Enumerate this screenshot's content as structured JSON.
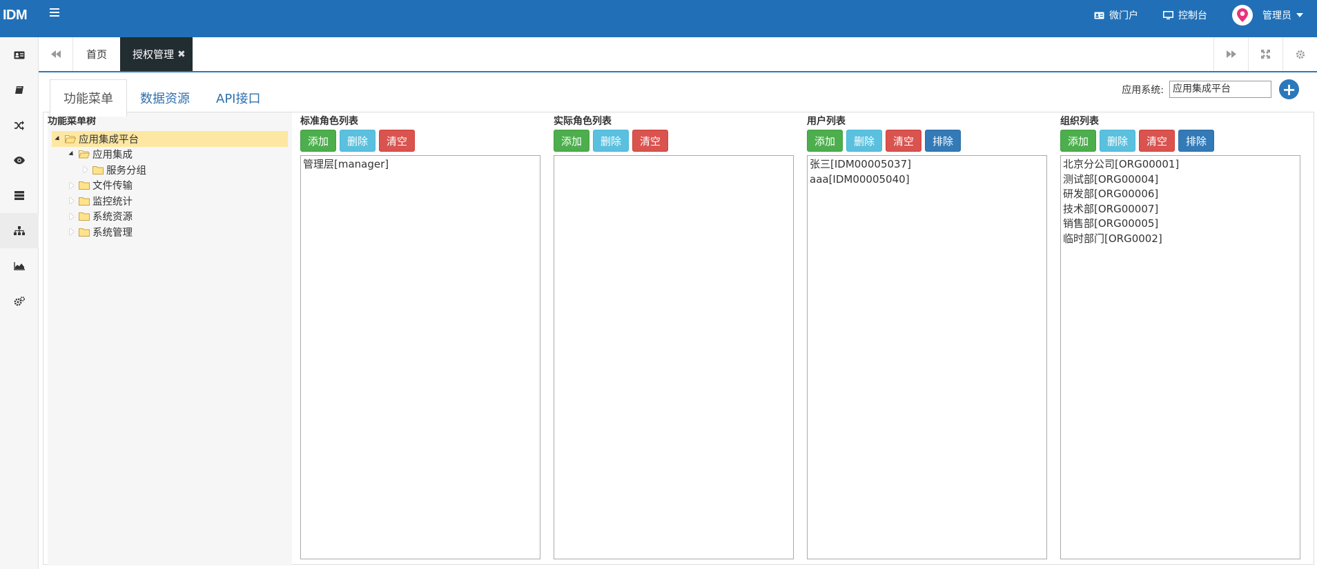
{
  "navbar": {
    "logo": "IDM",
    "links": [
      {
        "label": "微门户",
        "icon": "id-card-icon"
      },
      {
        "label": "控制台",
        "icon": "monitor-icon"
      }
    ],
    "user": "管理员",
    "accent": "#2170b7"
  },
  "sidebar": {
    "items": [
      {
        "icon": "id-card-icon"
      },
      {
        "icon": "book-icon"
      },
      {
        "icon": "shuffle-icon"
      },
      {
        "icon": "eye-icon"
      },
      {
        "icon": "server-icon"
      },
      {
        "icon": "sitemap-icon",
        "active": true
      },
      {
        "icon": "area-chart-icon"
      },
      {
        "icon": "cogs-icon"
      }
    ]
  },
  "tabs": {
    "home": "首页",
    "current": "授权管理"
  },
  "subtabs": [
    "功能菜单",
    "数据资源",
    "API接口"
  ],
  "app_selector": {
    "label": "应用系统:",
    "value": "应用集成平台"
  },
  "tree": {
    "title": "功能菜单树",
    "nodes": [
      {
        "label": "应用集成平台",
        "level": 0,
        "expanded": true,
        "selected": true
      },
      {
        "label": "应用集成",
        "level": 1,
        "expanded": true
      },
      {
        "label": "服务分组",
        "level": 2,
        "expanded": false
      },
      {
        "label": "文件传输",
        "level": 1,
        "expanded": false
      },
      {
        "label": "监控统计",
        "level": 1,
        "expanded": false
      },
      {
        "label": "系统资源",
        "level": 1,
        "expanded": false
      },
      {
        "label": "系统管理",
        "level": 1,
        "expanded": false
      }
    ]
  },
  "buttons": {
    "add": "添加",
    "delete": "删除",
    "clear": "清空",
    "exclude": "排除"
  },
  "lists": {
    "standard_roles": {
      "title": "标准角色列表",
      "items": [
        "管理层[manager]"
      ]
    },
    "actual_roles": {
      "title": "实际角色列表",
      "items": []
    },
    "users": {
      "title": "用户列表",
      "items": [
        "张三[IDM00005037]",
        "aaa[IDM00005040]"
      ]
    },
    "orgs": {
      "title": "组织列表",
      "items": [
        "北京分公司[ORG00001]",
        "测试部[ORG00004]",
        "研发部[ORG00006]",
        "技术部[ORG00007]",
        "销售部[ORG00005]",
        "临时部门[ORG0002]"
      ]
    }
  }
}
